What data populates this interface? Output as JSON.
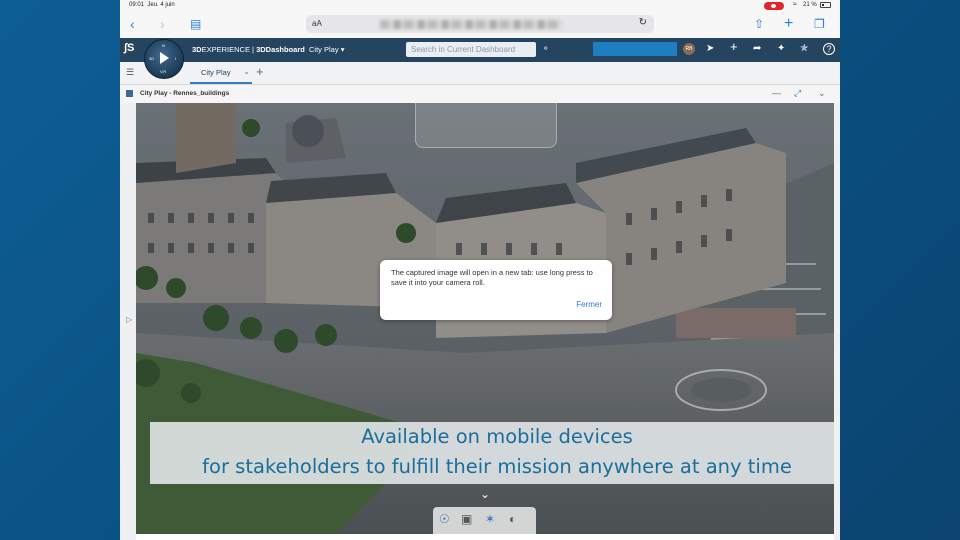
{
  "status_bar": {
    "time": "09:01",
    "date": "Jeu. 4 juin",
    "battery": "21 %"
  },
  "safari": {
    "text_size": "aA"
  },
  "app": {
    "brand": "3D",
    "brand_rest": "EXPERIENCE",
    "separator": " | ",
    "dashboard": "3DDashboard",
    "dashboard_name": "City Play",
    "search_placeholder": "Search in Current Dashboard",
    "avatar_initials": "RB"
  },
  "tabs": [
    {
      "label": "City Play"
    }
  ],
  "widget": {
    "title": "City Play - Rennes_buildings"
  },
  "dialog": {
    "message": "The captured image will open in a new tab: use long press to save it into your camera roll.",
    "close_label": "Fermer"
  },
  "caption": {
    "line1": "Available on mobile devices",
    "line2": "for stakeholders to fulfill their mission anywhere at any time"
  },
  "colors": {
    "header": "#24445f",
    "accent": "#1d7ec0",
    "caption_text": "#1a6e9c"
  }
}
